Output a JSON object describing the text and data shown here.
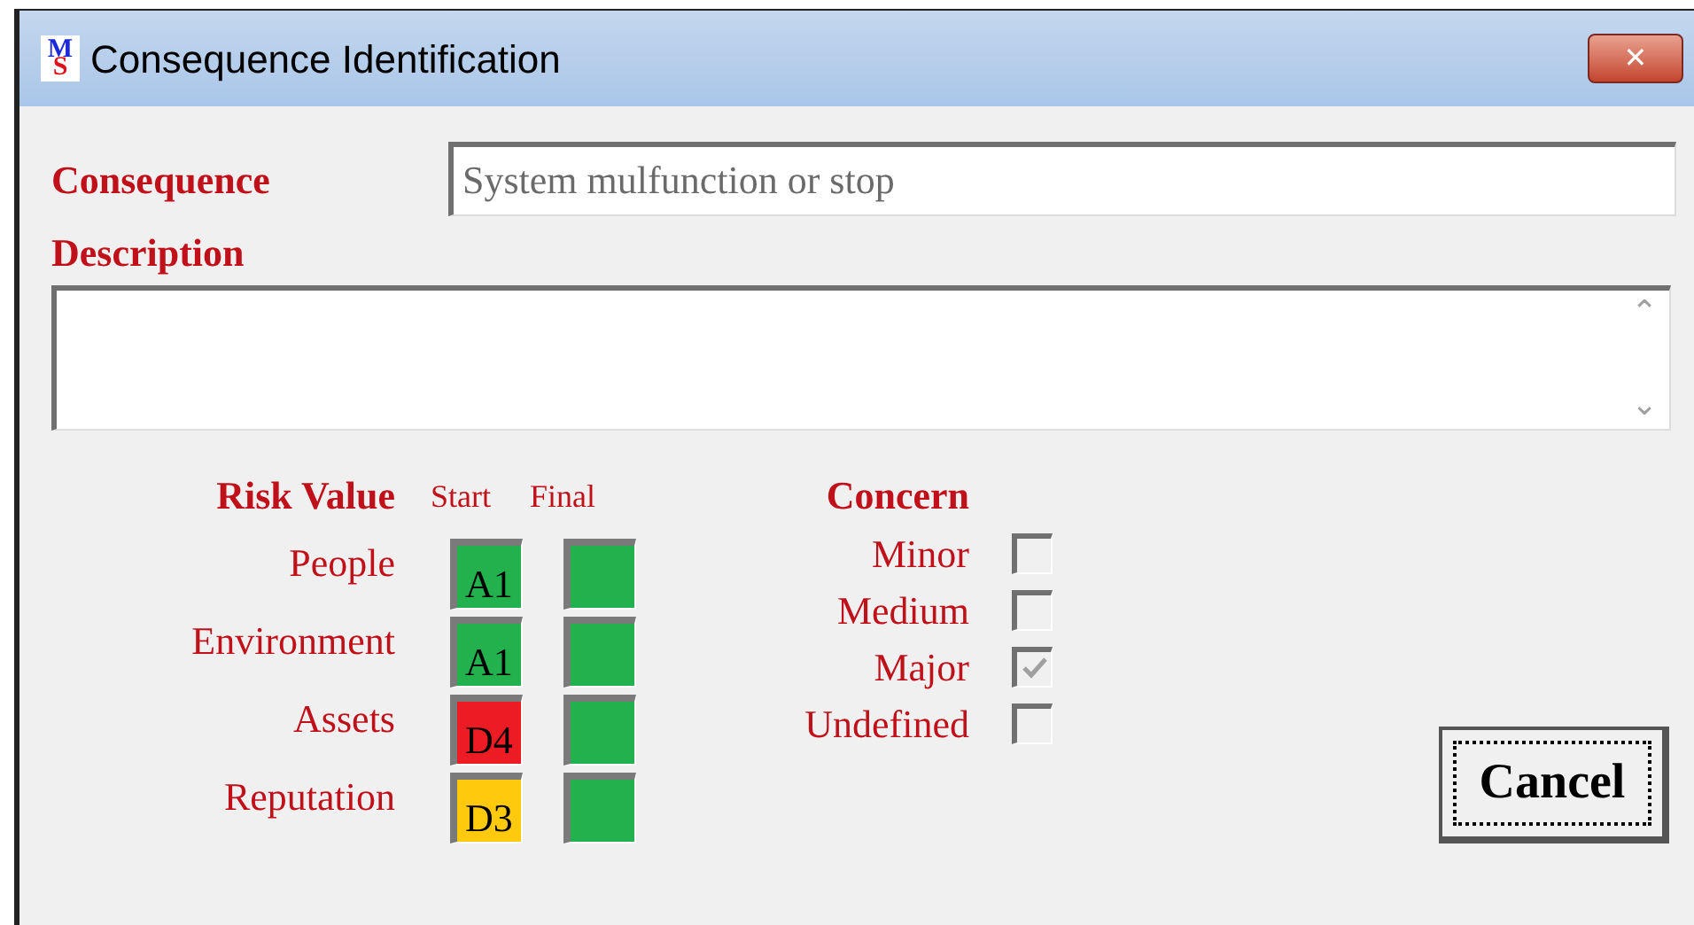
{
  "window": {
    "title": "Consequence Identification",
    "logo": {
      "top": "M",
      "bottom": "S"
    },
    "close": "✕"
  },
  "consequence": {
    "label": "Consequence",
    "value": "System mulfunction or stop"
  },
  "description": {
    "label": "Description",
    "scroll_up": "⌃",
    "scroll_down": "⌄"
  },
  "risk": {
    "label": "Risk Value",
    "columns": [
      "Start",
      "Final"
    ],
    "rows": [
      {
        "name": "People",
        "start": {
          "text": "A1",
          "color": "#22b14c"
        },
        "final": {
          "color": "#22b14c"
        }
      },
      {
        "name": "Environment",
        "start": {
          "text": "A1",
          "color": "#22b14c"
        },
        "final": {
          "color": "#22b14c"
        }
      },
      {
        "name": "Assets",
        "start": {
          "text": "D4",
          "color": "#ed1c24"
        },
        "final": {
          "color": "#22b14c"
        }
      },
      {
        "name": "Reputation",
        "start": {
          "text": "D3",
          "color": "#ffc90e"
        },
        "final": {
          "color": "#22b14c"
        }
      }
    ]
  },
  "concern": {
    "label": "Concern",
    "options": [
      {
        "label": "Minor",
        "checked": false
      },
      {
        "label": "Medium",
        "checked": false
      },
      {
        "label": "Major",
        "checked": true
      },
      {
        "label": "Undefined",
        "checked": false
      }
    ]
  },
  "buttons": {
    "cancel": "Cancel"
  }
}
